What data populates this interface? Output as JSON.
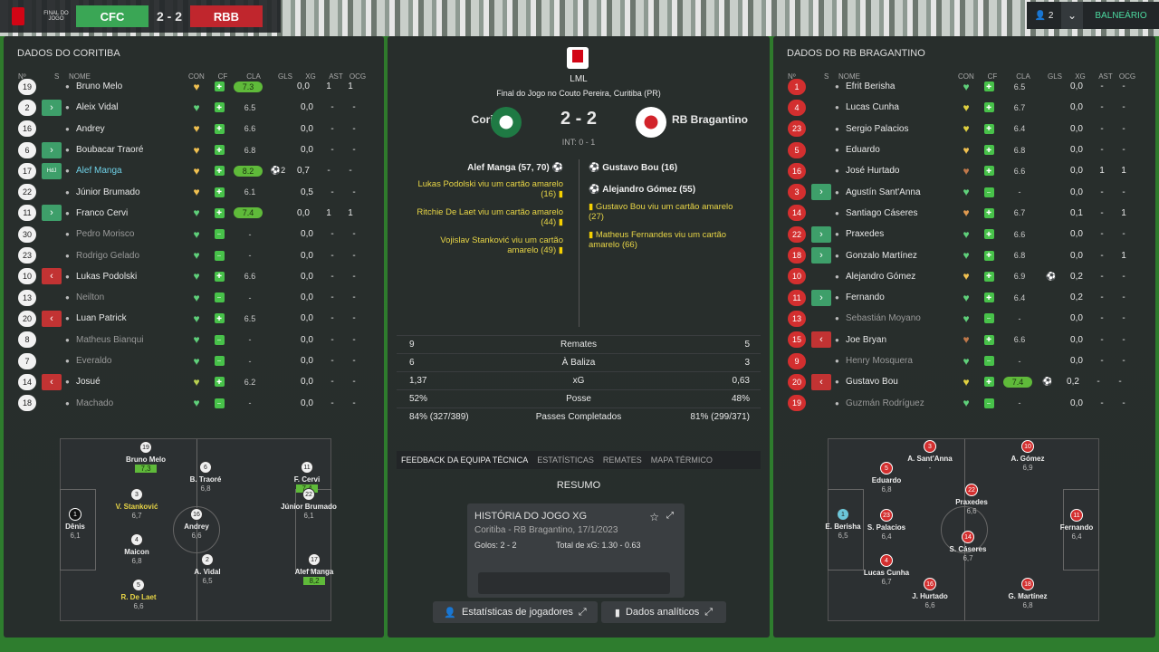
{
  "header": {
    "ft_label": "FINAL DO JOGO",
    "home_abbr": "CFC",
    "score": "2 - 2",
    "away_abbr": "RBB",
    "users": "2",
    "balneario": "BALNEÁRIO"
  },
  "columns": [
    "Nº",
    "S",
    "NOME",
    "CON",
    "CF",
    "CLA",
    "GLS",
    "XG",
    "AST",
    "OCG"
  ],
  "left": {
    "title": "DADOS DO CORITIBA",
    "rows": [
      {
        "n": "19",
        "s": "",
        "name": "Bruno Melo",
        "h": "#f0c050",
        "cla": "7.3",
        "cb": true,
        "g": "",
        "xg": "0,0",
        "a": "1",
        "o": "1"
      },
      {
        "n": "2",
        "s": ">",
        "name": "Aleix Vidal",
        "h": "#5fd07a",
        "cla": "6.5",
        "g": "",
        "xg": "0,0",
        "a": "-",
        "o": "-"
      },
      {
        "n": "16",
        "s": "",
        "name": "Andrey",
        "h": "#f0c050",
        "cla": "6.6",
        "g": "",
        "xg": "0,0",
        "a": "-",
        "o": "-"
      },
      {
        "n": "6",
        "s": ">",
        "name": "Boubacar Traoré",
        "h": "#f0c050",
        "cla": "6.8",
        "g": "",
        "xg": "0,0",
        "a": "-",
        "o": "-"
      },
      {
        "n": "17",
        "s": "HdJ",
        "name": "Alef Manga",
        "hl": true,
        "h": "#f0c050",
        "cla": "8.2",
        "cb": true,
        "g": "⚽2",
        "xg": "0,7",
        "a": "-",
        "o": "-"
      },
      {
        "n": "22",
        "s": "",
        "name": "Júnior Brumado",
        "h": "#f0c050",
        "cla": "6.1",
        "g": "",
        "xg": "0,5",
        "a": "-",
        "o": "-"
      },
      {
        "n": "11",
        "s": ">",
        "name": "Franco Cervi",
        "h": "#5fd07a",
        "cla": "7.4",
        "cb": true,
        "g": "",
        "xg": "0,0",
        "a": "1",
        "o": "1"
      },
      {
        "n": "30",
        "s": "",
        "name": "Pedro Morisco",
        "dim": true,
        "h": "#5fd07a",
        "cla": "-",
        "g": "",
        "xg": "0,0",
        "a": "-",
        "o": "-"
      },
      {
        "n": "23",
        "s": "",
        "name": "Rodrigo Gelado",
        "dim": true,
        "h": "#5fd07a",
        "cla": "-",
        "g": "",
        "xg": "0,0",
        "a": "-",
        "o": "-"
      },
      {
        "n": "10",
        "s": "<",
        "nred": true,
        "name": "Lukas Podolski",
        "h": "#5fd07a",
        "cla": "6.6",
        "g": "",
        "xg": "0,0",
        "a": "-",
        "o": "-"
      },
      {
        "n": "13",
        "s": "",
        "name": "Neilton",
        "dim": true,
        "h": "#5fd07a",
        "cla": "-",
        "g": "",
        "xg": "0,0",
        "a": "-",
        "o": "-"
      },
      {
        "n": "20",
        "s": "<",
        "name": "Luan Patrick",
        "h": "#5fd07a",
        "cla": "6.5",
        "g": "",
        "xg": "0,0",
        "a": "-",
        "o": "-"
      },
      {
        "n": "8",
        "s": "",
        "name": "Matheus Bianqui",
        "dim": true,
        "h": "#5fd07a",
        "cla": "-",
        "g": "",
        "xg": "0,0",
        "a": "-",
        "o": "-"
      },
      {
        "n": "7",
        "s": "",
        "name": "Everaldo",
        "dim": true,
        "h": "#5fd07a",
        "cla": "-",
        "g": "",
        "xg": "0,0",
        "a": "-",
        "o": "-"
      },
      {
        "n": "14",
        "s": "<",
        "name": "Josué",
        "h": "#b8d050",
        "cla": "6.2",
        "g": "",
        "xg": "0,0",
        "a": "-",
        "o": "-"
      },
      {
        "n": "18",
        "s": "",
        "name": "Machado",
        "dim": true,
        "h": "#5fd07a",
        "cla": "-",
        "g": "",
        "xg": "0,0",
        "a": "-",
        "o": "-"
      }
    ]
  },
  "right": {
    "title": "DADOS DO RB BRAGANTINO",
    "rows": [
      {
        "n": "1",
        "s": "",
        "name": "Efrit Berisha",
        "h": "#5fd07a",
        "cla": "6.5",
        "g": "",
        "xg": "0,0",
        "a": "-",
        "o": "-"
      },
      {
        "n": "4",
        "s": "",
        "name": "Lucas Cunha",
        "h": "#e0d040",
        "cla": "6.7",
        "g": "",
        "xg": "0,0",
        "a": "-",
        "o": "-"
      },
      {
        "n": "23",
        "s": "",
        "name": "Sergio Palacios",
        "h": "#e0d040",
        "cla": "6.4",
        "g": "",
        "xg": "0,0",
        "a": "-",
        "o": "-"
      },
      {
        "n": "5",
        "s": "",
        "name": "Eduardo",
        "h": "#f0c050",
        "cla": "6.8",
        "g": "",
        "xg": "0,0",
        "a": "-",
        "o": "-"
      },
      {
        "n": "16",
        "s": "",
        "name": "José Hurtado",
        "h": "#c0784a",
        "cla": "6.6",
        "g": "",
        "xg": "0,0",
        "a": "1",
        "o": "1"
      },
      {
        "n": "3",
        "s": ">",
        "name": "Agustín Sant'Anna",
        "h": "#5fd07a",
        "cla": "-",
        "g": "",
        "xg": "0,0",
        "a": "-",
        "o": "-"
      },
      {
        "n": "14",
        "s": "",
        "name": "Santiago Cáseres",
        "h": "#e09a50",
        "cla": "6.7",
        "g": "",
        "xg": "0,1",
        "a": "-",
        "o": "1"
      },
      {
        "n": "22",
        "s": ">",
        "name": "Praxedes",
        "h": "#5fd07a",
        "cla": "6.6",
        "g": "",
        "xg": "0,0",
        "a": "-",
        "o": "-"
      },
      {
        "n": "18",
        "s": ">",
        "name": "Gonzalo Martínez",
        "h": "#5fd07a",
        "cla": "6.8",
        "g": "",
        "xg": "0,0",
        "a": "-",
        "o": "1"
      },
      {
        "n": "10",
        "s": "",
        "name": "Alejandro Gómez",
        "h": "#f0c050",
        "cla": "6.9",
        "g": "⚽",
        "xg": "0,2",
        "a": "-",
        "o": "-"
      },
      {
        "n": "11",
        "s": ">",
        "name": "Fernando",
        "h": "#5fd07a",
        "cla": "6.4",
        "g": "",
        "xg": "0,2",
        "a": "-",
        "o": "-"
      },
      {
        "n": "13",
        "s": "",
        "name": "Sebastián Moyano",
        "dim": true,
        "h": "#5fd07a",
        "cla": "-",
        "g": "",
        "xg": "0,0",
        "a": "-",
        "o": "-"
      },
      {
        "n": "15",
        "s": "<",
        "name": "Joe Bryan",
        "h": "#c0784a",
        "cla": "6.6",
        "g": "",
        "xg": "0,0",
        "a": "-",
        "o": "-"
      },
      {
        "n": "9",
        "s": "",
        "name": "Henry Mosquera",
        "dim": true,
        "h": "#5fd07a",
        "cla": "-",
        "g": "",
        "xg": "0,0",
        "a": "-",
        "o": "-"
      },
      {
        "n": "20",
        "s": "<",
        "name": "Gustavo Bou",
        "h": "#e0d040",
        "cla": "7.4",
        "cb": true,
        "g": "⚽",
        "xg": "0,2",
        "a": "-",
        "o": "-"
      },
      {
        "n": "19",
        "s": "",
        "name": "Guzmán Rodríguez",
        "dim": true,
        "h": "#5fd07a",
        "cla": "-",
        "g": "",
        "xg": "0,0",
        "a": "-",
        "o": "-"
      }
    ]
  },
  "match": {
    "league": "LML",
    "venue": "Final do Jogo no Couto Pereira, Curitiba (PR)",
    "home": "Coritiba",
    "away": "RB Bragantino",
    "score": "2 - 2",
    "ht": "INT: 0 - 1",
    "home_events": [
      "Alef Manga (57, 70)",
      "Lukas Podolski viu um cartão amarelo (16)",
      "Ritchie De Laet viu um cartão amarelo (44)",
      "Vojislav Stanković viu um cartão amarelo (49)"
    ],
    "away_events": [
      "Gustavo Bou (16)",
      "Alejandro Gómez (55)",
      "Gustavo Bou viu um cartão amarelo (27)",
      "Matheus Fernandes viu um cartão amarelo (66)"
    ]
  },
  "stats": [
    {
      "h": "9",
      "l": "Remates",
      "a": "5"
    },
    {
      "h": "6",
      "l": "À Baliza",
      "a": "3"
    },
    {
      "h": "1,37",
      "l": "xG",
      "a": "0,63"
    },
    {
      "h": "52%",
      "l": "Posse",
      "a": "48%"
    },
    {
      "h": "84% (327/389)",
      "l": "Passes Completados",
      "a": "81% (299/371)"
    }
  ],
  "tabs": [
    "FEEDBACK DA EQUIPA TÉCNICA",
    "ESTATÍSTICAS",
    "REMATES",
    "MAPA TÉRMICO"
  ],
  "resumo": "RESUMO",
  "xg_card": {
    "title": "HISTÓRIA DO JOGO XG",
    "sub": "Coritiba - RB Bragantino, 17/1/2023",
    "goals": "Golos: 2 - 2",
    "total": "Total de xG: 1.30 - 0.63"
  },
  "buttons": {
    "players": "Estatísticas de jogadores",
    "analytics": "Dados analíticos"
  },
  "home_formation": [
    {
      "n": "19",
      "name": "Bruno Melo",
      "r": "7,3",
      "b": true
    },
    {
      "n": "6",
      "name": "B. Traoré",
      "r": "6,8"
    },
    {
      "n": "11",
      "name": "F. Cervi",
      "r": "7,4",
      "b": true
    },
    {
      "n": "3",
      "name": "V. Stanković",
      "r": "6,7",
      "y": true
    },
    {
      "n": "22",
      "name": "Júnior Brumado",
      "r": "6,1"
    },
    {
      "n": "1",
      "name": "Dênis",
      "r": "6,1",
      "k": true
    },
    {
      "n": "16",
      "name": "Andrey",
      "r": "6,6"
    },
    {
      "n": "4",
      "name": "Maicon",
      "r": "6,8"
    },
    {
      "n": "17",
      "name": "Alef Manga",
      "r": "8,2",
      "b": true
    },
    {
      "n": "2",
      "name": "A. Vidal",
      "r": "6,5"
    },
    {
      "n": "5",
      "name": "R. De Laet",
      "r": "6,6",
      "y": true
    }
  ],
  "away_formation": [
    {
      "n": "3",
      "name": "A. Sant'Anna",
      "r": "-"
    },
    {
      "n": "10",
      "name": "A. Gómez",
      "r": "6,9"
    },
    {
      "n": "5",
      "name": "Eduardo",
      "r": "6,8"
    },
    {
      "n": "22",
      "name": "Praxedes",
      "r": "6,6"
    },
    {
      "n": "1",
      "name": "E. Berisha",
      "r": "6,5",
      "c": true
    },
    {
      "n": "23",
      "name": "S. Palacios",
      "r": "6,4"
    },
    {
      "n": "14",
      "name": "S. Cáseres",
      "r": "6,7"
    },
    {
      "n": "11",
      "name": "Fernando",
      "r": "6,4"
    },
    {
      "n": "4",
      "name": "Lucas Cunha",
      "r": "6,7"
    },
    {
      "n": "16",
      "name": "J. Hurtado",
      "r": "6,6"
    },
    {
      "n": "18",
      "name": "G. Martínez",
      "r": "6,8"
    }
  ]
}
